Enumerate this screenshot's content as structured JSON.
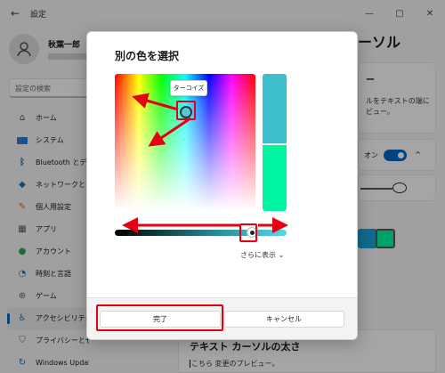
{
  "app": {
    "title": "設定",
    "back_icon": "back-arrow-icon"
  },
  "window_controls": [
    "minimize-icon",
    "maximize-icon",
    "close-icon"
  ],
  "profile": {
    "name": "秋葉一郎"
  },
  "search": {
    "placeholder": "設定の検索"
  },
  "sidebar": {
    "items": [
      {
        "label": "ホーム",
        "icon": "home-icon",
        "active": false
      },
      {
        "label": "システム",
        "icon": "system-icon",
        "active": false
      },
      {
        "label": "Bluetooth とデバ",
        "icon": "bluetooth-icon",
        "active": false
      },
      {
        "label": "ネットワークとインタ",
        "icon": "network-icon",
        "active": false
      },
      {
        "label": "個人用設定",
        "icon": "personalization-icon",
        "active": false
      },
      {
        "label": "アプリ",
        "icon": "apps-icon",
        "active": false
      },
      {
        "label": "アカウント",
        "icon": "accounts-icon",
        "active": false
      },
      {
        "label": "時刻と言語",
        "icon": "time-language-icon",
        "active": false
      },
      {
        "label": "ゲーム",
        "icon": "gaming-icon",
        "active": false
      },
      {
        "label": "アクセシビリティ",
        "icon": "accessibility-icon",
        "active": true
      },
      {
        "label": "プライバシーとセキュリティ",
        "icon": "privacy-icon",
        "active": false
      },
      {
        "label": "Windows Update",
        "icon": "windows-update-icon",
        "active": false
      }
    ]
  },
  "right_panel": {
    "title": "ーソル",
    "card_a": {
      "heading": "ー",
      "text_line1": "ルをテキストの端に",
      "text_line2": "ビュー。"
    },
    "toggle_label": "オン",
    "swatch_colors": [
      "#1aa0d8",
      "#00f5a0"
    ]
  },
  "bottom_section": {
    "title": "テキスト カーソルの太さ",
    "subtitle_before": "こちら",
    "subtitle_after": " 変更のプレビュー。"
  },
  "dialog": {
    "title": "別の色を選択",
    "tooltip": "ターコイズ",
    "more_label": "さらに表示",
    "done_label": "完了",
    "cancel_label": "キャンセル",
    "current_color": "#3ebfcc",
    "previous_color": "#00f5a0"
  }
}
